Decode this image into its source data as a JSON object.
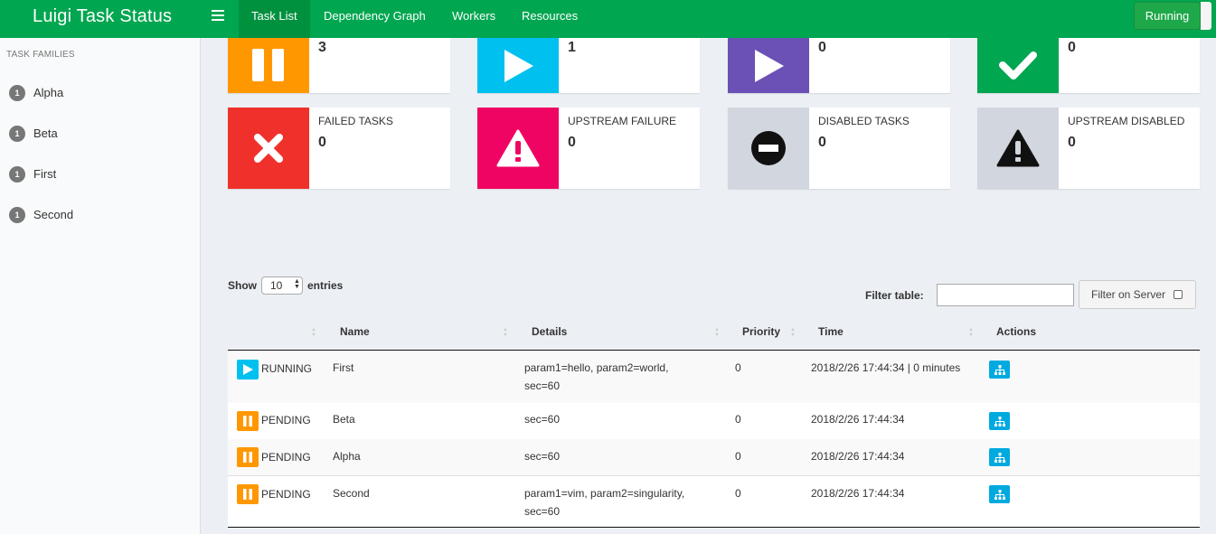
{
  "app": {
    "title": "Luigi Task Status"
  },
  "nav": {
    "tabs": [
      {
        "label": "Task List",
        "active": true
      },
      {
        "label": "Dependency Graph"
      },
      {
        "label": "Workers"
      },
      {
        "label": "Resources"
      }
    ],
    "status_button": "Running"
  },
  "sidebar": {
    "heading": "TASK FAMILIES",
    "families": [
      {
        "count": "1",
        "name": "Alpha"
      },
      {
        "count": "1",
        "name": "Beta"
      },
      {
        "count": "1",
        "name": "First"
      },
      {
        "count": "1",
        "name": "Second"
      }
    ]
  },
  "status_boxes": [
    {
      "count": "3",
      "color": "#ff9800",
      "icon": "pause-icon"
    },
    {
      "count": "1",
      "color": "#00c0ef",
      "icon": "play-icon"
    },
    {
      "count": "0",
      "color": "#6b51b5",
      "icon": "play-icon"
    },
    {
      "count": "0",
      "color": "#00a650",
      "icon": "check-icon"
    },
    {
      "title": "FAILED TASKS",
      "count": "0",
      "color": "#f0312b",
      "icon": "x-icon"
    },
    {
      "title": "UPSTREAM FAILURE",
      "count": "0",
      "color": "#f00463",
      "icon": "warning-icon"
    },
    {
      "title": "DISABLED TASKS",
      "count": "0",
      "color": "#d2d6de",
      "icon": "minus-circle-icon"
    },
    {
      "title": "UPSTREAM DISABLED",
      "count": "0",
      "color": "#d2d6de",
      "icon": "warning-icon"
    }
  ],
  "table_controls": {
    "show_label": "Show",
    "page_size": "10",
    "entries_label": "entries",
    "filter_label": "Filter table:",
    "filter_server_label": "Filter on Server"
  },
  "table": {
    "columns": [
      "Name",
      "Details",
      "Priority",
      "Time",
      "Actions"
    ],
    "rows": [
      {
        "status": "RUNNING",
        "status_color": "#00c0ef",
        "name": "First",
        "details_line1": "param1=hello, param2=world,",
        "details_line2": "sec=60",
        "priority": "0",
        "time": "2018/2/26 17:44:34 | 0 minutes"
      },
      {
        "status": "PENDING",
        "status_color": "#ff9800",
        "name": "Beta",
        "details_line1": "sec=60",
        "details_line2": "",
        "priority": "0",
        "time": "2018/2/26 17:44:34"
      },
      {
        "status": "PENDING",
        "status_color": "#ff9800",
        "name": "Alpha",
        "details_line1": "sec=60",
        "details_line2": "",
        "priority": "0",
        "time": "2018/2/26 17:44:34"
      },
      {
        "status": "PENDING",
        "status_color": "#ff9800",
        "name": "Second",
        "details_line1": "param1=vim, param2=singularity,",
        "details_line2": "sec=60",
        "priority": "0",
        "time": "2018/2/26 17:44:34"
      }
    ]
  }
}
